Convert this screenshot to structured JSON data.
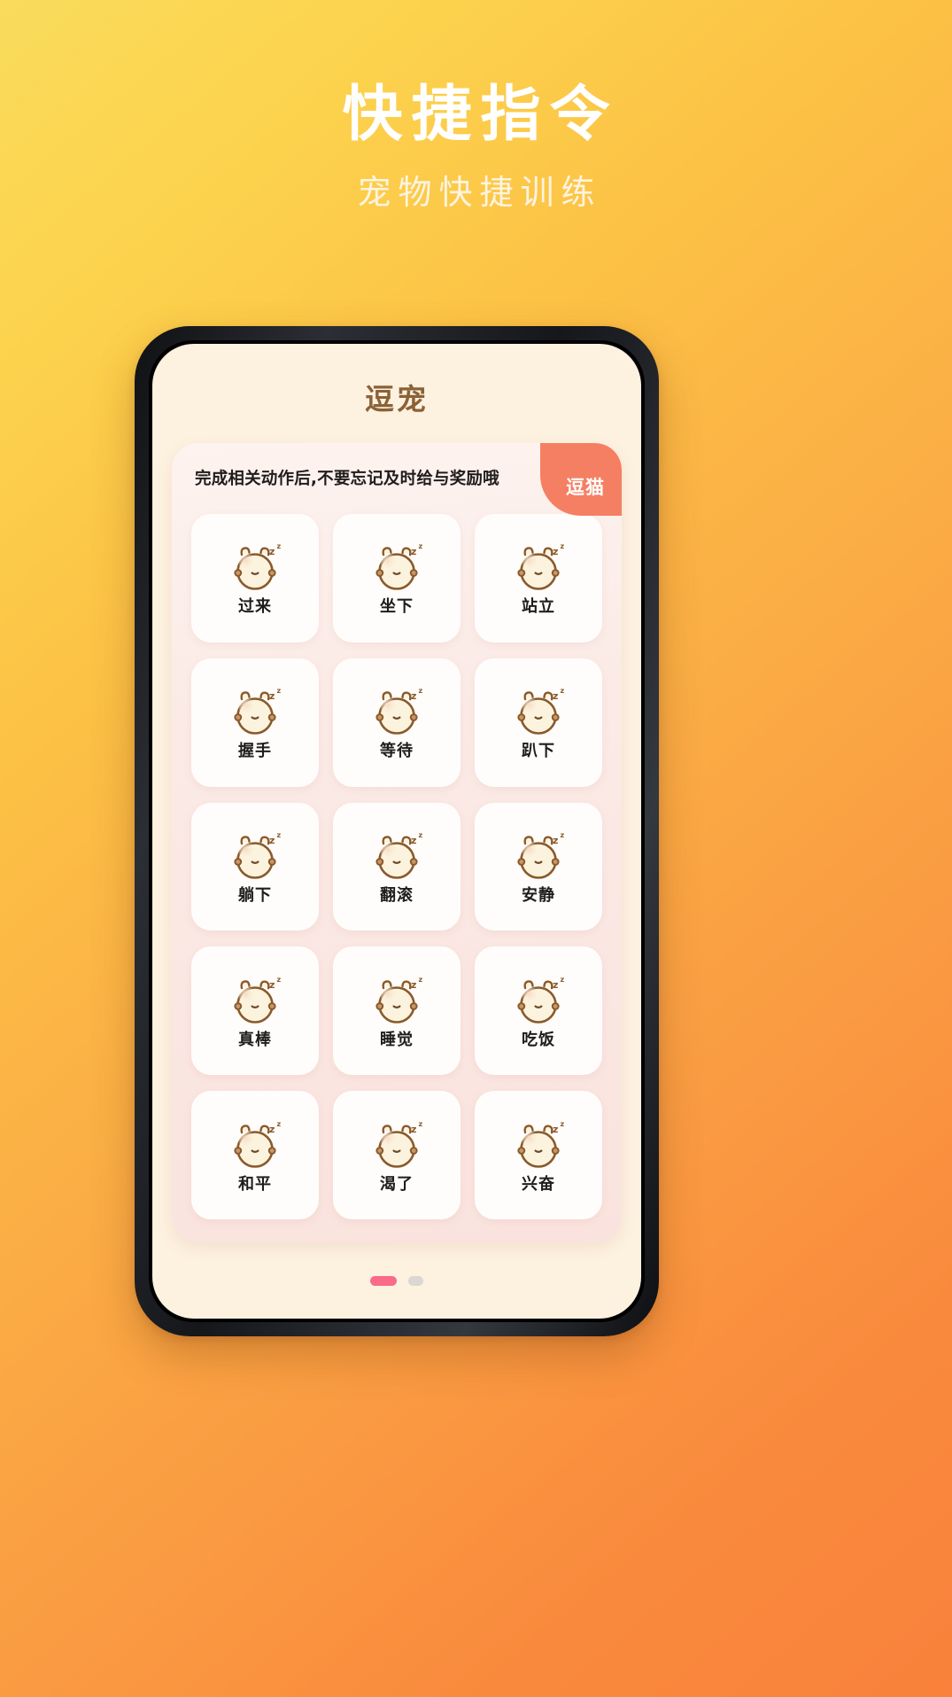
{
  "promo": {
    "title": "快捷指令",
    "subtitle": "宠物快捷训练"
  },
  "app": {
    "title": "逗宠"
  },
  "panel": {
    "tip": "完成相关动作后,不要忘记及时给与奖励哦",
    "corner_badge": "逗猫"
  },
  "commands": [
    {
      "label": "过来",
      "icon": "sleeping-pet-face-icon"
    },
    {
      "label": "坐下",
      "icon": "sleeping-pet-face-icon"
    },
    {
      "label": "站立",
      "icon": "sleeping-pet-face-icon"
    },
    {
      "label": "握手",
      "icon": "sleeping-pet-face-icon"
    },
    {
      "label": "等待",
      "icon": "sleeping-pet-face-icon"
    },
    {
      "label": "趴下",
      "icon": "sleeping-pet-face-icon"
    },
    {
      "label": "躺下",
      "icon": "sleeping-pet-face-icon"
    },
    {
      "label": "翻滚",
      "icon": "sleeping-pet-face-icon"
    },
    {
      "label": "安静",
      "icon": "sleeping-pet-face-icon"
    },
    {
      "label": "真棒",
      "icon": "sleeping-pet-face-icon"
    },
    {
      "label": "睡觉",
      "icon": "sleeping-pet-face-icon"
    },
    {
      "label": "吃饭",
      "icon": "sleeping-pet-face-icon"
    },
    {
      "label": "和平",
      "icon": "sleeping-pet-face-icon"
    },
    {
      "label": "渴了",
      "icon": "sleeping-pet-face-icon"
    },
    {
      "label": "兴奋",
      "icon": "sleeping-pet-face-icon"
    }
  ],
  "pager": {
    "total": 2,
    "active_index": 0
  },
  "colors": {
    "bg_gradient_start": "#fadb5c",
    "bg_gradient_end": "#f9813b",
    "promo_title": "#ffffff",
    "promo_subtitle": "#fdf3e0",
    "screen_bg": "#fdf1e0",
    "app_title": "#8a6236",
    "panel_bg": "#fbeae6",
    "card_bg": "#fffdfb",
    "badge_bg": "#f57f63",
    "label_text": "#1f1d1c",
    "pager_active": "#fa6a8b",
    "pager_inactive": "#dcd7d2",
    "icon_outline": "#8a5a2b",
    "icon_fill": "#fcf3df"
  }
}
